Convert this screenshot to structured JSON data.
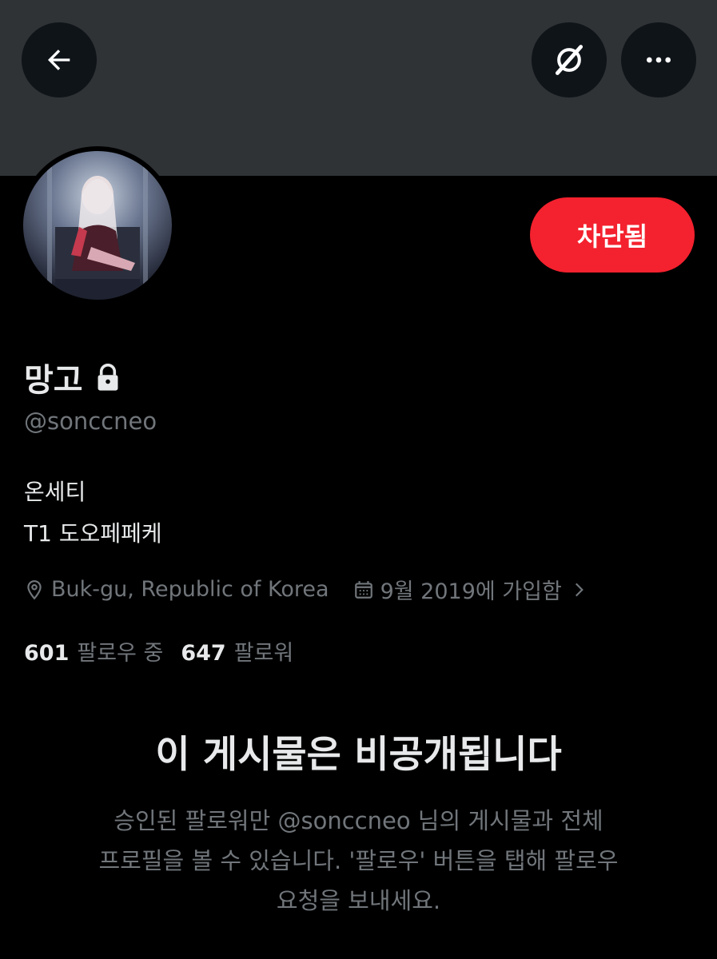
{
  "header": {
    "back_icon": "arrow-left-icon",
    "grok_icon": "grok-icon",
    "more_icon": "more-horizontal-icon"
  },
  "profile": {
    "display_name": "망고",
    "lock_icon": "lock-icon",
    "handle": "@sonccneo",
    "blocked_label": "차단됨",
    "bio_lines": [
      "온세티",
      "T1 도오페페케"
    ],
    "location": "Buk-gu, Republic of Korea",
    "joined": "9월 2019에 가입함",
    "following_count": "601",
    "following_label": "팔로우 중",
    "followers_count": "647",
    "followers_label": "팔로워"
  },
  "private_notice": {
    "title": "이 게시물은 비공개됩니다",
    "lines": [
      "승인된 팔로워만 @sonccneo 님의 게시물과 전체",
      "프로필을 볼 수 있습니다. '팔로우' 버튼을 탭해 팔로우",
      "요청을 보내세요."
    ]
  },
  "colors": {
    "background": "#000000",
    "banner": "#2f3336",
    "blocked_button": "#f4212e",
    "primary_text": "#e7e9ea",
    "secondary_text": "#71767b"
  }
}
